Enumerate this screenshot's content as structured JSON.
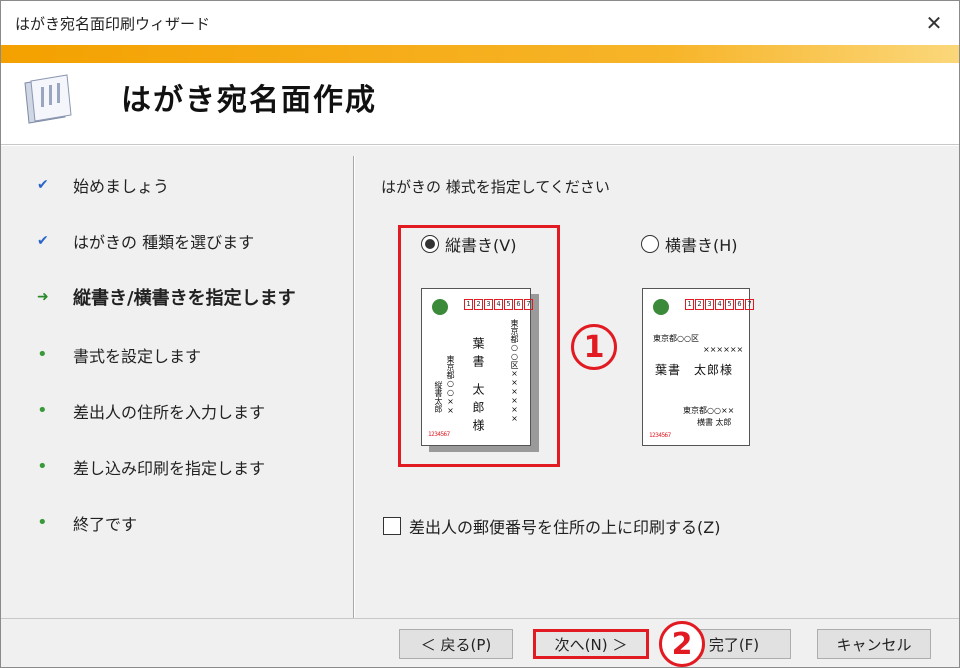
{
  "window": {
    "title": "はがき宛名面印刷ウィザード",
    "close_glyph": "✕"
  },
  "header": {
    "title": "はがき宛名面作成",
    "icon": "wizard-document-icon"
  },
  "steps": [
    {
      "label": "始めましょう",
      "state": "done",
      "glyph": "✔"
    },
    {
      "label": "はがきの 種類を選びます",
      "state": "done",
      "glyph": "✔"
    },
    {
      "label": "縦書き/横書きを指定します",
      "state": "current",
      "glyph": "➜"
    },
    {
      "label": "書式を設定します",
      "state": "todo",
      "glyph": "•"
    },
    {
      "label": "差出人の住所を入力します",
      "state": "todo",
      "glyph": "•"
    },
    {
      "label": "差し込み印刷を指定します",
      "state": "todo",
      "glyph": "•"
    },
    {
      "label": "終了です",
      "state": "todo",
      "glyph": "•"
    }
  ],
  "main": {
    "instruction": "はがきの 様式を指定してください",
    "options": [
      {
        "label": "縦書き(V)",
        "selected": true
      },
      {
        "label": "横書き(H)",
        "selected": false
      }
    ],
    "checkbox": {
      "label": "差出人の郵便番号を住所の上に印刷する(Z)",
      "checked": false
    },
    "annotations": {
      "one": "1",
      "two": "2"
    }
  },
  "preview": {
    "zip_digits": [
      "1",
      "2",
      "3",
      "4",
      "5",
      "6",
      "7"
    ],
    "sender_zip": "1234567",
    "vertical": {
      "recipient_address": "東京都○○区××××××",
      "recipient_name": "葉書 太郎様",
      "sender_address": "東京都○○××",
      "sender_name": "縦書太郎"
    },
    "horizontal": {
      "recipient_address": "東京都○○区",
      "recipient_address2": "××××××",
      "recipient_name": "葉書　太郎様",
      "sender_address": "東京都○○××",
      "sender_name": "横書 太郎"
    }
  },
  "footer": {
    "back": "＜ 戻る(P)",
    "next": "次へ(N) ＞",
    "finish": "完了(F)",
    "cancel": "キャンセル"
  },
  "colors": {
    "accent_orange": "#f4a100",
    "highlight_red": "#e21a22",
    "stamp_green": "#3a8a3a"
  }
}
